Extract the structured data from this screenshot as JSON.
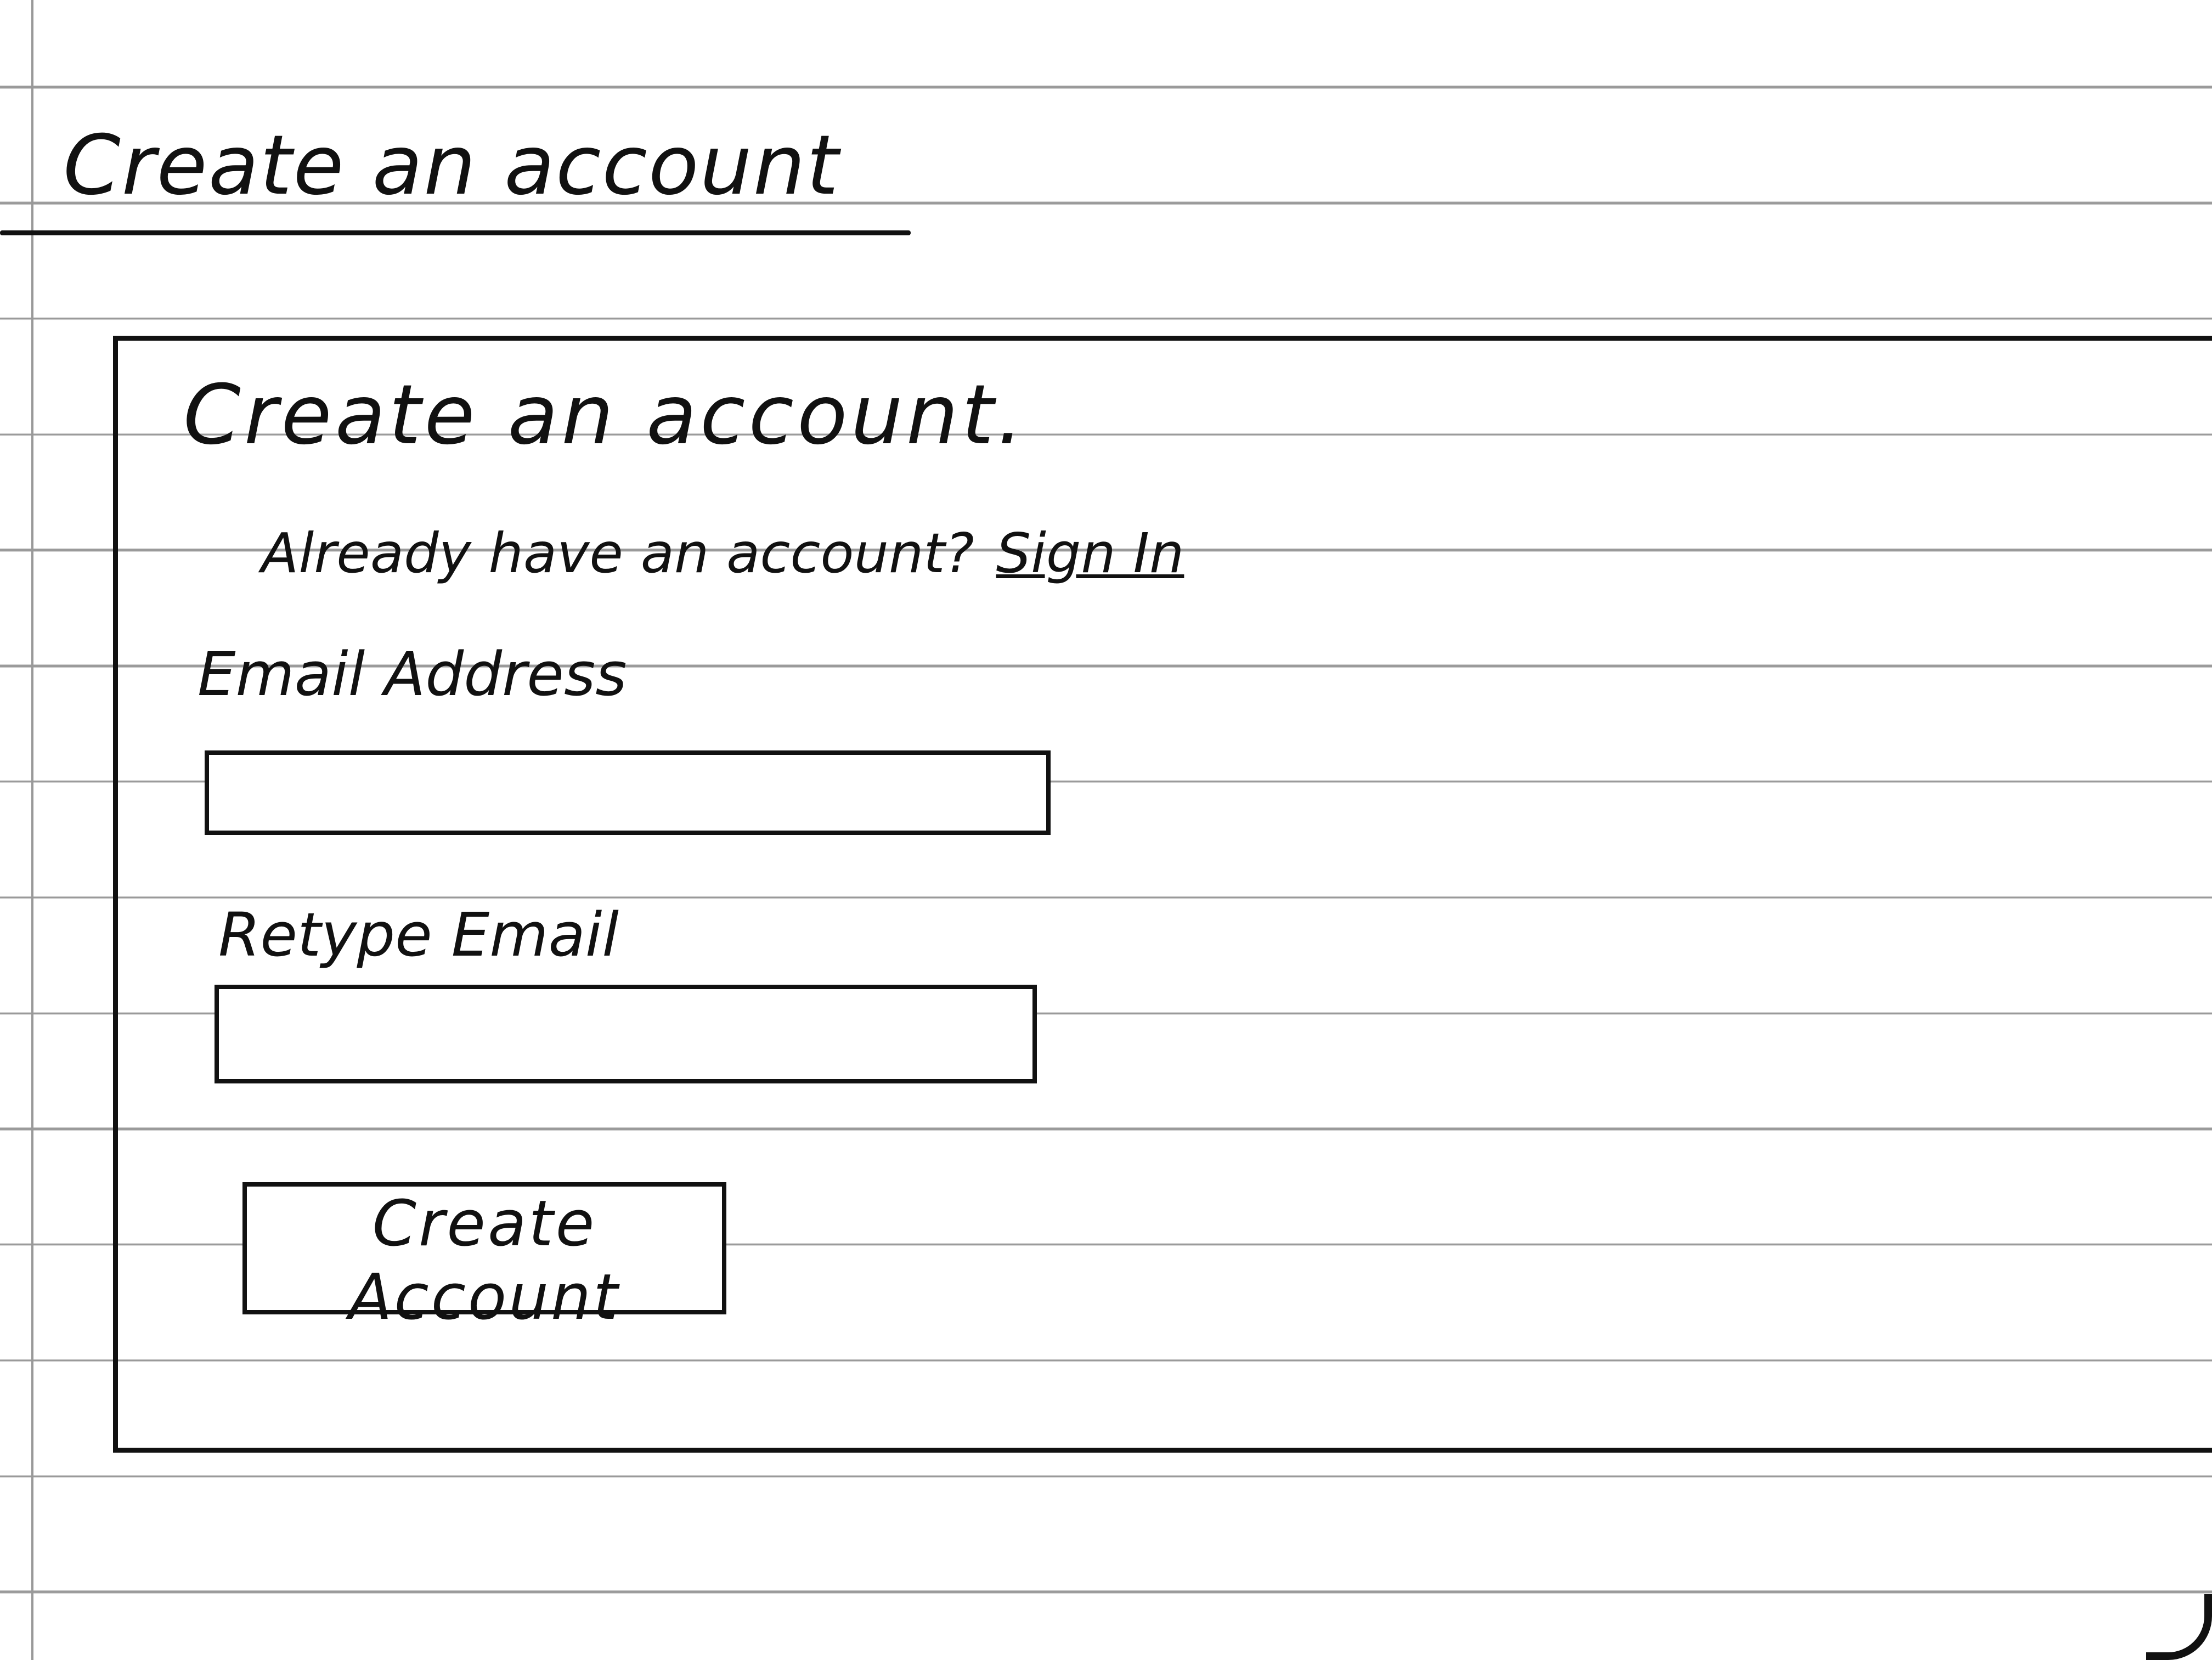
{
  "page": {
    "title": "Create an account"
  },
  "form": {
    "title": "Create an account.",
    "subtitle": "Already have an account?",
    "signin_link": "Sign In",
    "email_label": "Email Address",
    "email_value": "",
    "retype_label": "Retype Email",
    "retype_value": "",
    "submit_label": "Create Account"
  }
}
